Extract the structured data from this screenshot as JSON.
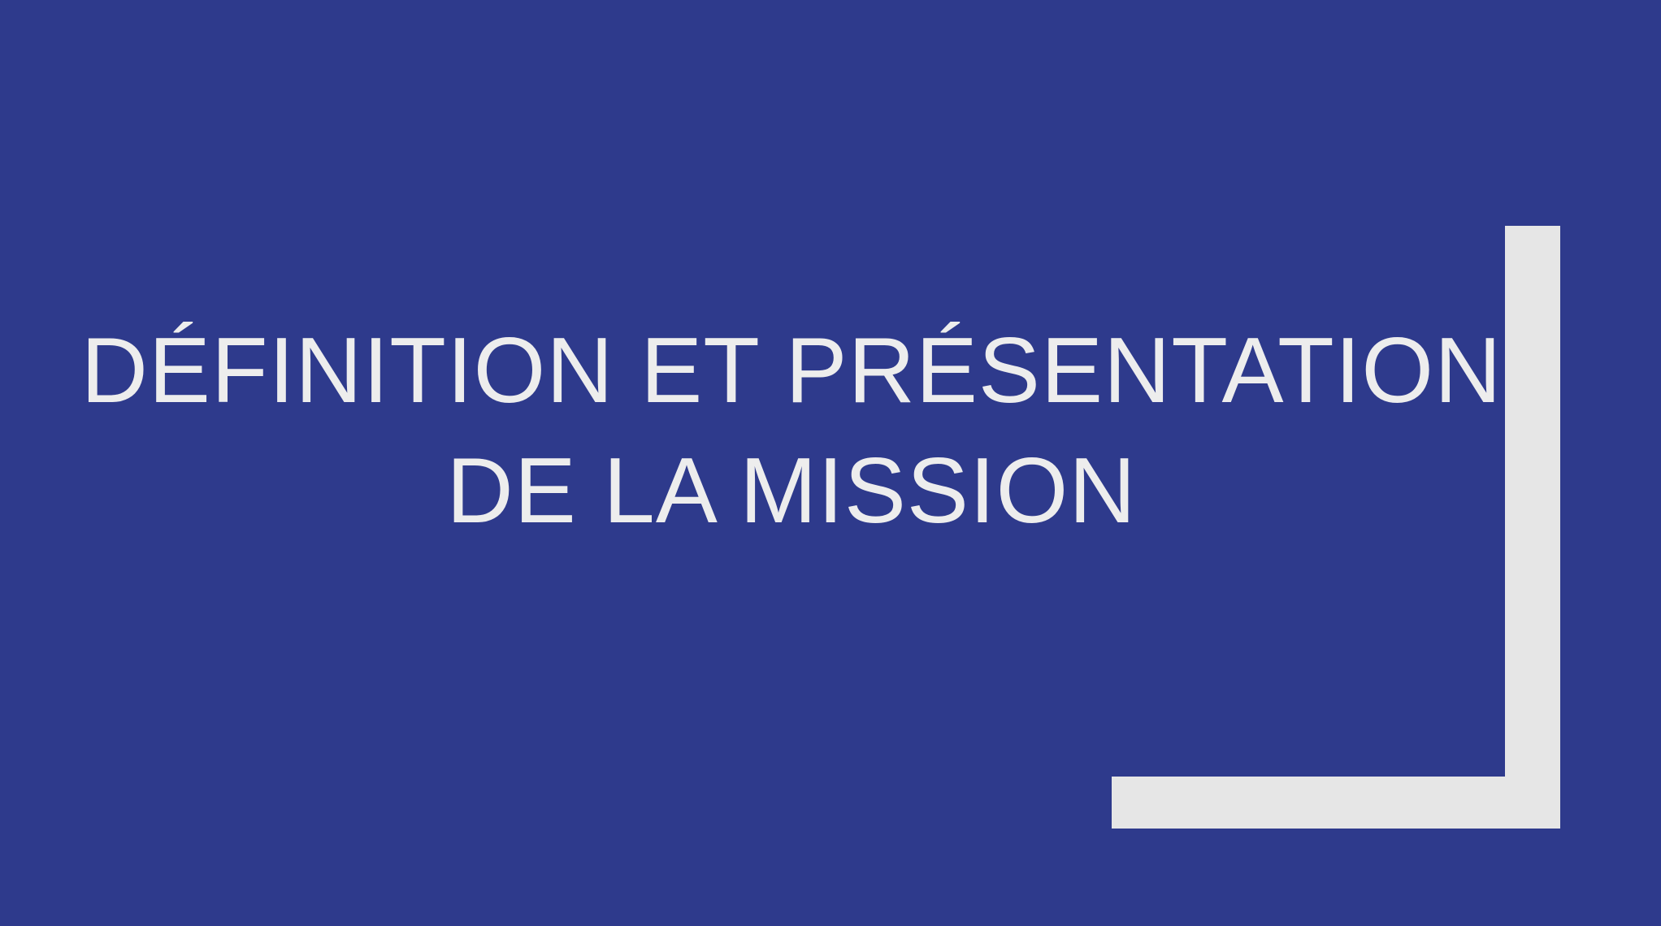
{
  "slide": {
    "background_color": "#2E3A8C",
    "accent_color": "#E6E6E6",
    "text_color": "#EDEDED",
    "title_lines": [
      "DÉFINITION ET PRÉSENTATION",
      "DE LA MISSION"
    ]
  }
}
